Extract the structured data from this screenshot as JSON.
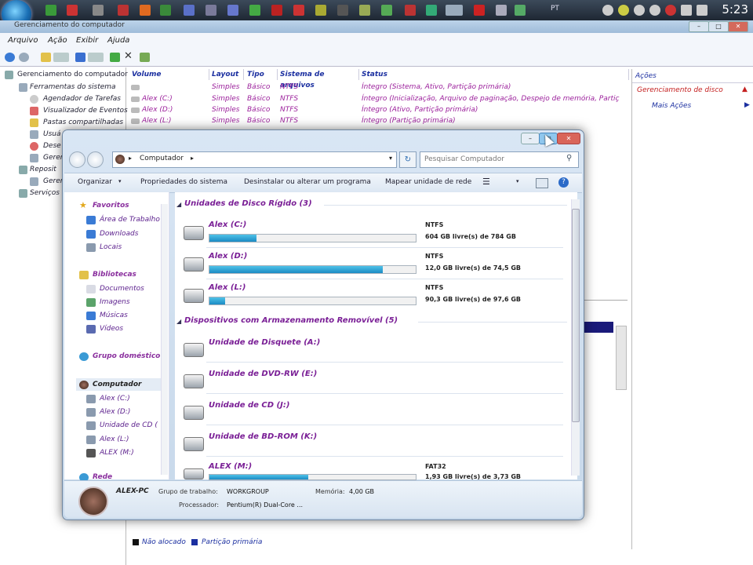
{
  "taskbar": {
    "lang": "PT",
    "clock": "5:23"
  },
  "mmc": {
    "title": "Gerenciamento do computador",
    "menus": [
      "Arquivo",
      "Ação",
      "Exibir",
      "Ajuda"
    ],
    "tree": [
      "Gerenciamento do computador",
      "Ferramentas do sistema",
      "Agendador de Tarefas",
      "Visualizador de Eventos",
      "Pastas compartilhadas",
      "Usuá",
      "Dese",
      "Geren",
      "Reposit",
      "Geren",
      "Serviços"
    ],
    "columns": [
      "Volume",
      "Layout",
      "Tipo",
      "Sistema de arquivos",
      "Status"
    ],
    "rows": [
      {
        "volume": "",
        "layout": "Simples",
        "tipo": "Básico",
        "fs": "NTFS",
        "status": "Íntegro (Sistema, Ativo, Partição primária)"
      },
      {
        "volume": "Alex (C:)",
        "layout": "Simples",
        "tipo": "Básico",
        "fs": "NTFS",
        "status": "Íntegro (Inicialização, Arquivo de paginação, Despejo de memória, Partiç"
      },
      {
        "volume": "Alex (D:)",
        "layout": "Simples",
        "tipo": "Básico",
        "fs": "NTFS",
        "status": "Íntegro (Ativo, Partição primária)"
      },
      {
        "volume": "Alex (L:)",
        "layout": "Simples",
        "tipo": "Básico",
        "fs": "NTFS",
        "status": "Íntegro (Partição primária)"
      }
    ],
    "actions_title": "Ações",
    "actions_item": "Gerenciamento de disco",
    "actions_more": "Mais Ações",
    "legend": [
      "Não alocado",
      "Partição primária"
    ]
  },
  "explorer": {
    "address": "Computador",
    "search_placeholder": "Pesquisar Computador",
    "commands": [
      "Organizar",
      "Propriedades do sistema",
      "Desinstalar ou alterar um programa",
      "Mapear unidade de rede"
    ],
    "nav": {
      "favorites": "Favoritos",
      "fav_items": [
        "Área de Trabalho",
        "Downloads",
        "Locais"
      ],
      "libraries": "Bibliotecas",
      "lib_items": [
        "Documentos",
        "Imagens",
        "Músicas",
        "Vídeos"
      ],
      "homegroup": "Grupo doméstico",
      "computer": "Computador",
      "comp_items": [
        "Alex (C:)",
        "Alex (D:)",
        "Unidade de CD (",
        "Alex (L:)",
        "ALEX (M:)"
      ],
      "network": "Rede"
    },
    "group_hdd": "Unidades de Disco Rígido (3)",
    "group_removable": "Dispositivos com Armazenamento Removível (5)",
    "drives": [
      {
        "name": "Alex (C:)",
        "fs": "NTFS",
        "space": "604 GB livre(s) de 784 GB",
        "used": 0.23
      },
      {
        "name": "Alex (D:)",
        "fs": "NTFS",
        "space": "12,0 GB livre(s) de 74,5 GB",
        "used": 0.84
      },
      {
        "name": "Alex (L:)",
        "fs": "NTFS",
        "space": "90,3 GB livre(s) de 97,6 GB",
        "used": 0.075
      }
    ],
    "removable": [
      "Unidade de Disquete (A:)",
      "Unidade de DVD-RW (E:)",
      "Unidade de CD (J:)",
      "Unidade de BD-ROM (K:)"
    ],
    "usb": {
      "name": "ALEX (M:)",
      "fs": "FAT32",
      "space": "1,93 GB livre(s) de 3,73 GB",
      "used": 0.48
    },
    "details": {
      "pc_name": "ALEX-PC",
      "workgroup_label": "Grupo de trabalho:",
      "workgroup": "WORKGROUP",
      "memory_label": "Memória:",
      "memory": "4,00 GB",
      "processor_label": "Processador:",
      "processor": "Pentium(R) Dual-Core ..."
    }
  }
}
